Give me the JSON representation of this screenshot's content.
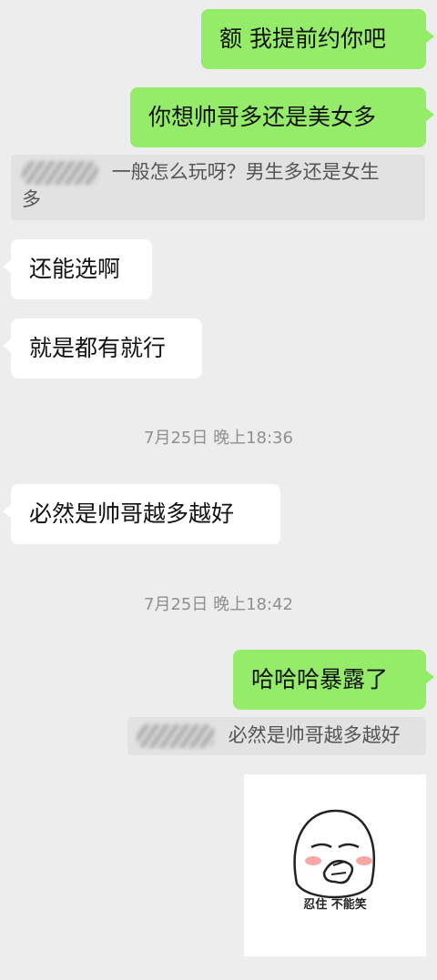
{
  "messages": [
    {
      "text": "额 我提前约你吧"
    },
    {
      "text": "你想帅哥多还是美女多"
    },
    {
      "text": "一般怎么玩呀？男生多还是女生多"
    },
    {
      "text": "还能选啊"
    },
    {
      "text": "就是都有就行"
    },
    {
      "text": "必然是帅哥越多越好"
    },
    {
      "text": "哈哈哈暴露了"
    },
    {
      "text": "必然是帅哥越多越好"
    }
  ],
  "quote1": {
    "line1": "一般怎么玩呀？男生多还是女生",
    "line2": "多"
  },
  "timestamps": [
    "7月25日 晚上18:36",
    "7月25日 晚上18:42"
  ],
  "sticker": {
    "caption": "忍住 不能笑"
  },
  "colors": {
    "sent_bubble": "#95ec69",
    "received_bubble": "#ffffff",
    "background": "#ededed"
  }
}
